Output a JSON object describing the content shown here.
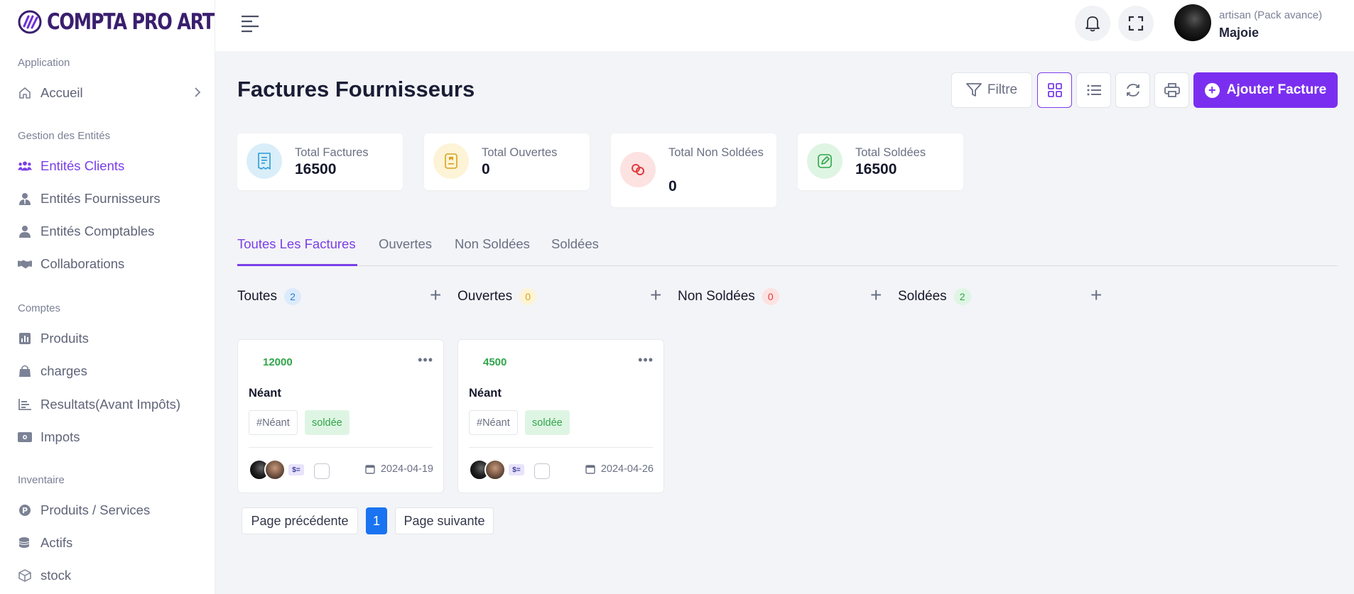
{
  "brand": {
    "name": "COMPTA PRO ART"
  },
  "sidebar": {
    "sections": [
      {
        "title": "Application"
      },
      {
        "title": "Gestion des Entités"
      },
      {
        "title": "Comptes"
      },
      {
        "title": "Inventaire"
      }
    ],
    "items": [
      {
        "label": "Accueil",
        "icon": "home-icon"
      },
      {
        "label": "Entités Clients",
        "icon": "users-icon",
        "active": true
      },
      {
        "label": "Entités Fournisseurs",
        "icon": "user-tie-icon"
      },
      {
        "label": "Entités Comptables",
        "icon": "user-icon"
      },
      {
        "label": "Collaborations",
        "icon": "handshake-icon"
      },
      {
        "label": "Produits",
        "icon": "bar-chart-icon"
      },
      {
        "label": "charges",
        "icon": "shopping-bag-icon"
      },
      {
        "label": "Resultats(Avant Impôts)",
        "icon": "chart-lines-icon"
      },
      {
        "label": "Impots",
        "icon": "money-icon"
      },
      {
        "label": "Produits / Services",
        "icon": "p-circle-icon"
      },
      {
        "label": "Actifs",
        "icon": "coins-icon"
      },
      {
        "label": "stock",
        "icon": "box-icon"
      }
    ]
  },
  "topbar": {
    "user_role": "artisan (Pack avance)",
    "user_name": "Majoie"
  },
  "page": {
    "title": "Factures Fournisseurs",
    "filter_label": "Filtre",
    "add_label": "Ajouter Facture"
  },
  "stats": [
    {
      "label": "Total Factures",
      "value": "16500",
      "color": "#2b9bd6",
      "bg": "#d9eef9"
    },
    {
      "label": "Total Ouvertes",
      "value": "0",
      "color": "#d7a31d",
      "bg": "#fdf3d6"
    },
    {
      "label": "Total Non Soldées",
      "value": "0",
      "color": "#e03c3c",
      "bg": "#fde2e2"
    },
    {
      "label": "Total Soldées",
      "value": "16500",
      "color": "#30a54a",
      "bg": "#dff5e4"
    }
  ],
  "tabs": [
    "Toutes Les Factures",
    "Ouvertes",
    "Non Soldées",
    "Soldées"
  ],
  "columns": [
    {
      "label": "Toutes",
      "count": "2"
    },
    {
      "label": "Ouvertes",
      "count": "0"
    },
    {
      "label": "Non Soldées",
      "count": "0"
    },
    {
      "label": "Soldées",
      "count": "2"
    }
  ],
  "cards": [
    {
      "amount": "12000",
      "title": "Néant",
      "tag": "#Néant",
      "status": "soldée",
      "money_icon": "$=",
      "date": "2024-04-19"
    },
    {
      "amount": "4500",
      "title": "Néant",
      "tag": "#Néant",
      "status": "soldée",
      "money_icon": "$=",
      "date": "2024-04-26"
    }
  ],
  "pagination": {
    "prev": "Page précédente",
    "current": "1",
    "next": "Page suivante"
  },
  "colors": {
    "accent": "#7a3ee8",
    "add_button": "#7a2ff0",
    "page_current": "#1a73f0"
  }
}
